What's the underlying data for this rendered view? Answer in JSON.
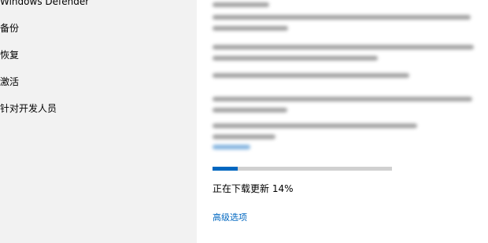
{
  "sidebar": {
    "items": [
      {
        "label": "Windows Defender"
      },
      {
        "label": "备份"
      },
      {
        "label": "恢复"
      },
      {
        "label": "激活"
      },
      {
        "label": "针对开发人员"
      }
    ]
  },
  "update": {
    "progress_fraction": 0.14,
    "status_text": "正在下载更新 14%",
    "advanced_options_label": "高级选项"
  },
  "colors": {
    "accent": "#0067c0",
    "sidebar_bg": "#f2f2f2",
    "progress_track": "#d0d0d0"
  }
}
